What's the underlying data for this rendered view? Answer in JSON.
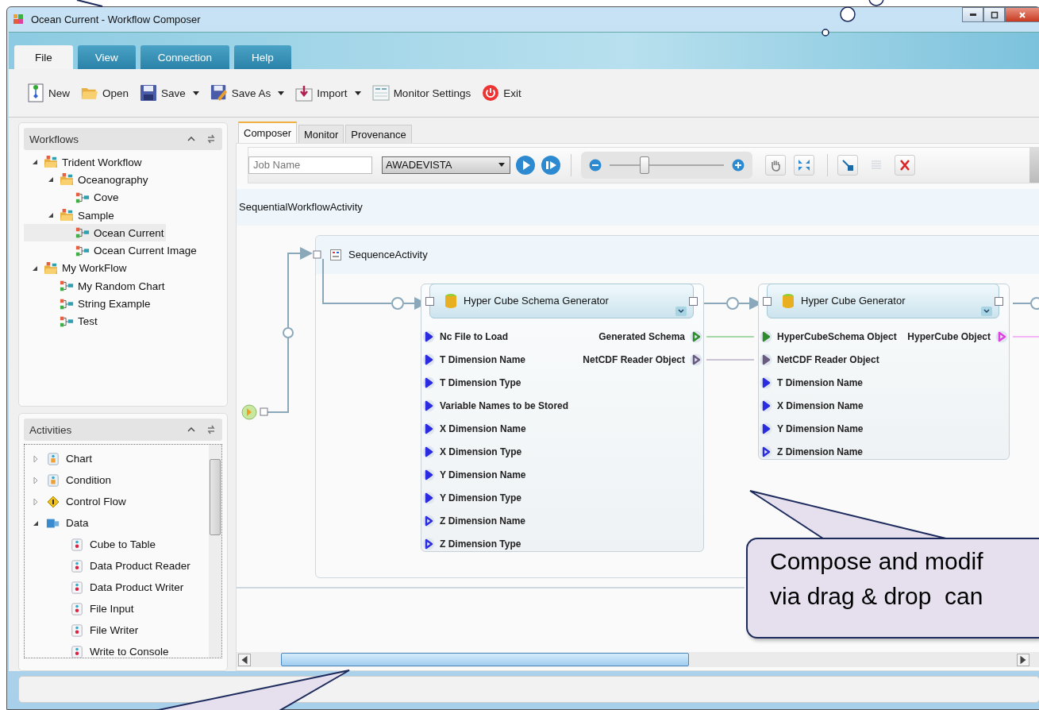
{
  "window": {
    "title": "Ocean Current - Workflow Composer"
  },
  "ribbon_tabs": [
    {
      "label": "File",
      "selected": true
    },
    {
      "label": "View",
      "selected": false
    },
    {
      "label": "Connection",
      "selected": false
    },
    {
      "label": "Help",
      "selected": false
    }
  ],
  "toolbar": [
    {
      "label": "New",
      "kind": "new",
      "dropdown": false
    },
    {
      "label": "Open",
      "kind": "open",
      "dropdown": false
    },
    {
      "label": "Save",
      "kind": "save",
      "dropdown": true
    },
    {
      "label": "Save As",
      "kind": "saveas",
      "dropdown": true
    },
    {
      "label": "Import",
      "kind": "import",
      "dropdown": true
    },
    {
      "label": "Monitor Settings",
      "kind": "monitor",
      "dropdown": false
    },
    {
      "label": "Exit",
      "kind": "exit",
      "dropdown": false
    }
  ],
  "workflows": {
    "title": "Workflows",
    "tree": [
      {
        "label": "Trident Workflow",
        "kind": "folder",
        "expanded": true,
        "selected": false,
        "children": [
          {
            "label": "Oceanography",
            "kind": "folder",
            "expanded": true,
            "selected": false,
            "children": [
              {
                "label": "Cove",
                "kind": "workflow",
                "selected": false
              }
            ]
          },
          {
            "label": "Sample",
            "kind": "folder",
            "expanded": true,
            "selected": false,
            "children": [
              {
                "label": "Ocean Current",
                "kind": "workflow",
                "selected": true
              },
              {
                "label": "Ocean Current Image",
                "kind": "workflow",
                "selected": false
              }
            ]
          }
        ]
      },
      {
        "label": "My WorkFlow",
        "kind": "folder",
        "expanded": true,
        "selected": false,
        "children": [
          {
            "label": "My Random Chart",
            "kind": "workflow",
            "selected": false
          },
          {
            "label": "String Example",
            "kind": "workflow",
            "selected": false
          },
          {
            "label": "Test",
            "kind": "workflow",
            "selected": false
          }
        ]
      }
    ]
  },
  "activities": {
    "title": "Activities",
    "tree": [
      {
        "label": "Chart",
        "kind": "group",
        "expanded": false
      },
      {
        "label": "Condition",
        "kind": "group",
        "expanded": false
      },
      {
        "label": "Control Flow",
        "kind": "flow",
        "expanded": false
      },
      {
        "label": "Data",
        "kind": "data",
        "expanded": true,
        "children": [
          {
            "label": "Cube to Table",
            "kind": "activity"
          },
          {
            "label": "Data Product Reader",
            "kind": "activity"
          },
          {
            "label": "Data Product Writer",
            "kind": "activity"
          },
          {
            "label": "File Input",
            "kind": "activity"
          },
          {
            "label": "File Writer",
            "kind": "activity"
          },
          {
            "label": "Write to Console",
            "kind": "activity"
          }
        ]
      }
    ]
  },
  "doc_tabs": [
    {
      "label": "Composer",
      "selected": true
    },
    {
      "label": "Monitor",
      "selected": false
    },
    {
      "label": "Provenance",
      "selected": false
    }
  ],
  "composer_toolbar": {
    "job_name": {
      "placeholder": "Job Name"
    },
    "machine": "AWADEVISTA",
    "zoom": {
      "level": 0.3
    },
    "tools": [
      {
        "kind": "pan",
        "disabled": false
      },
      {
        "kind": "fit",
        "disabled": false
      },
      {
        "kind": "connect",
        "disabled": false
      },
      {
        "kind": "list",
        "disabled": true
      },
      {
        "kind": "delete",
        "disabled": false
      }
    ]
  },
  "canvas": {
    "root_label": "SequentialWorkflowActivity",
    "sequence_label": "SequenceActivity",
    "nodes": [
      {
        "title": "Hyper Cube Schema Generator",
        "inputs": [
          {
            "label": "Nc File to Load",
            "filled": true,
            "color": "#2b2be0"
          },
          {
            "label": "T Dimension Name",
            "filled": true,
            "color": "#2b2be0"
          },
          {
            "label": "T Dimension Type",
            "filled": true,
            "color": "#2b2be0"
          },
          {
            "label": "Variable Names to be Stored",
            "filled": true,
            "color": "#2b2be0"
          },
          {
            "label": "X Dimension Name",
            "filled": true,
            "color": "#2b2be0"
          },
          {
            "label": "X Dimension Type",
            "filled": true,
            "color": "#2b2be0"
          },
          {
            "label": "Y Dimension Name",
            "filled": true,
            "color": "#2b2be0"
          },
          {
            "label": "Y Dimension Type",
            "filled": true,
            "color": "#2b2be0"
          },
          {
            "label": "Z Dimension Name",
            "filled": false,
            "color": "#2b2be0"
          },
          {
            "label": "Z Dimension Type",
            "filled": false,
            "color": "#2b2be0"
          }
        ],
        "outputs": [
          {
            "label": "Generated Schema",
            "filled": false,
            "color": "#2e8b2e"
          },
          {
            "label": "NetCDF Reader Object",
            "filled": false,
            "color": "#6a5a80"
          }
        ]
      },
      {
        "title": "Hyper Cube Generator",
        "inputs": [
          {
            "label": "HyperCubeSchema Object",
            "filled": true,
            "color": "#2e8b2e"
          },
          {
            "label": "NetCDF Reader Object",
            "filled": true,
            "color": "#6a5a80"
          },
          {
            "label": "T Dimension Name",
            "filled": true,
            "color": "#2b2be0"
          },
          {
            "label": "X Dimension Name",
            "filled": true,
            "color": "#2b2be0"
          },
          {
            "label": "Y Dimension Name",
            "filled": true,
            "color": "#2b2be0"
          },
          {
            "label": "Z Dimension Name",
            "filled": false,
            "color": "#2b2be0"
          }
        ],
        "outputs": [
          {
            "label": "HyperCube Object",
            "filled": false,
            "color": "#e040e0"
          }
        ]
      }
    ]
  },
  "callout": {
    "lines": [
      "Compose and modif",
      "via drag & drop  can"
    ]
  }
}
